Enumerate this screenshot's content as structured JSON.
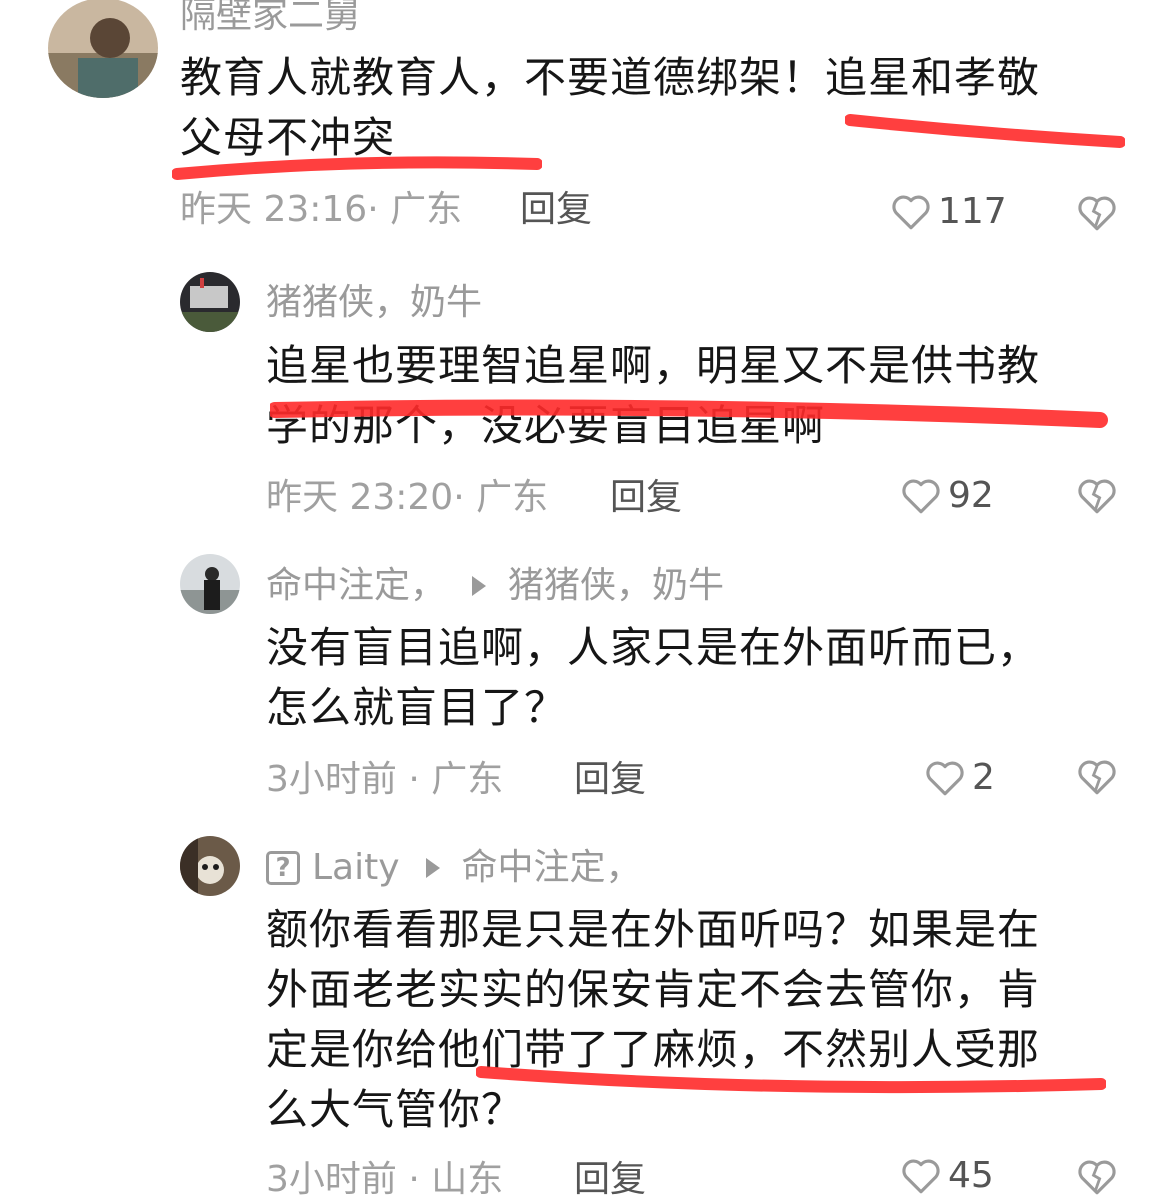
{
  "comments": [
    {
      "username": "隔壁家二舅",
      "lines": [
        "教育人就教育人，不要道德绑架！追星和孝敬",
        "父母不冲突"
      ],
      "time": "昨天 23:16",
      "location": "广东",
      "reply_label": "回复",
      "likes": "117",
      "icons": {
        "avatar": "avatar-photo",
        "like": "heart-outline-icon",
        "dislike": "broken-heart-icon"
      }
    },
    {
      "username": "猪猪侠，奶牛",
      "lines": [
        "追星也要理智追星啊，明星又不是供书教",
        "学的那个，没必要盲目追星啊"
      ],
      "time": "昨天 23:20",
      "location": "广东",
      "reply_label": "回复",
      "likes": "92"
    },
    {
      "username": "命中注定，",
      "reply_to": "猪猪侠，奶牛",
      "lines": [
        "没有盲目追啊，人家只是在外面听而已，",
        "怎么就盲目了？"
      ],
      "time": "3小时前",
      "location": "广东",
      "reply_label": "回复",
      "likes": "2"
    },
    {
      "badge": "?",
      "username": "Laity",
      "reply_to": "命中注定，",
      "lines": [
        "额你看看那是只是在外面听吗？如果是在",
        "外面老老实实的保安肯定不会去管你，肯",
        "定是你给他们带了了麻烦，不然别人受那",
        "么大气管你？"
      ],
      "time": "3小时前",
      "location": "山东",
      "reply_label": "回复",
      "likes": "45"
    }
  ],
  "meta_separator": "·",
  "colors": {
    "underline": "#ff2a2a",
    "meta": "#a0a0a0",
    "text": "#161616"
  }
}
